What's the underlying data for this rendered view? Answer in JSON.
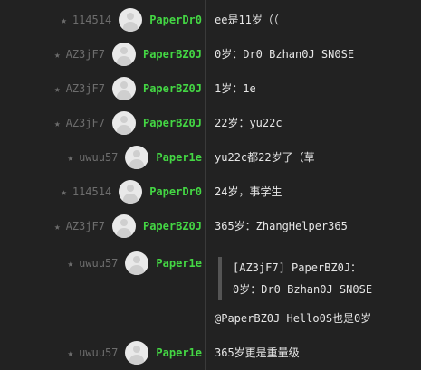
{
  "messages": [
    {
      "uid": "114514",
      "name": "PaperDr0",
      "text": "ee是11岁（（"
    },
    {
      "uid": "AZ3jF7",
      "name": "PaperBZ0J",
      "text": "0岁：Dr0 Bzhan0J SN0SE"
    },
    {
      "uid": "AZ3jF7",
      "name": "PaperBZ0J",
      "text": "1岁：1e"
    },
    {
      "uid": "AZ3jF7",
      "name": "PaperBZ0J",
      "text": "22岁：yu22c"
    },
    {
      "uid": "uwuu57",
      "name": "Paper1e",
      "text": "yu22c都22岁了（草"
    },
    {
      "uid": "114514",
      "name": "PaperDr0",
      "text": "24岁，事学生"
    },
    {
      "uid": "AZ3jF7",
      "name": "PaperBZ0J",
      "text": "365岁：ZhangHelper365"
    },
    {
      "uid": "uwuu57",
      "name": "Paper1e",
      "quote_line1": "[AZ3jF7] PaperBZ0J：",
      "quote_line2": "0岁：Dr0 Bzhan0J SN0SE",
      "text": "@PaperBZ0J Hello0S也是0岁"
    },
    {
      "uid": "uwuu57",
      "name": "Paper1e",
      "text": "365岁更是重量级"
    }
  ],
  "star_char": "★",
  "colors": {
    "background": "#222222",
    "name": "#44d744",
    "uid": "#6d6d6d",
    "text": "#e6e6e6"
  }
}
